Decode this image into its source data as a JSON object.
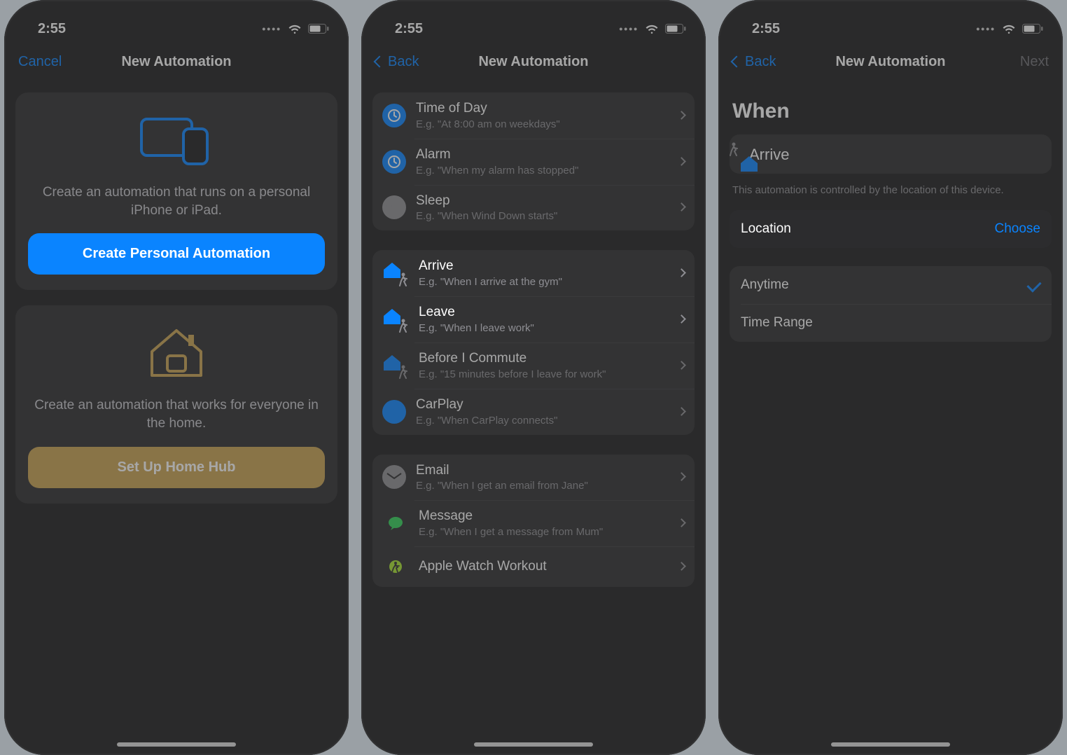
{
  "status": {
    "time": "2:55"
  },
  "screen1": {
    "nav_left": "Cancel",
    "nav_title": "New Automation",
    "personal_desc": "Create an automation that runs on a personal iPhone or iPad.",
    "personal_btn": "Create Personal Automation",
    "home_desc": "Create an automation that works for everyone in the home.",
    "home_btn": "Set Up Home Hub"
  },
  "screen2": {
    "nav_left": "Back",
    "nav_title": "New Automation",
    "groups": [
      [
        {
          "title": "Time of Day",
          "sub": "E.g. \"At 8:00 am on weekdays\"",
          "icon": "clock"
        },
        {
          "title": "Alarm",
          "sub": "E.g. \"When my alarm has stopped\"",
          "icon": "clock"
        },
        {
          "title": "Sleep",
          "sub": "E.g. \"When Wind Down starts\"",
          "icon": "bed"
        }
      ],
      [
        {
          "title": "Arrive",
          "sub": "E.g. \"When I arrive at the gym\"",
          "icon": "housewalker",
          "hl": true
        },
        {
          "title": "Leave",
          "sub": "E.g. \"When I leave work\"",
          "icon": "housewalker",
          "hl": true
        },
        {
          "title": "Before I Commute",
          "sub": "E.g. \"15 minutes before I leave for work\"",
          "icon": "housewalker"
        },
        {
          "title": "CarPlay",
          "sub": "E.g. \"When CarPlay connects\"",
          "icon": "carplay"
        }
      ],
      [
        {
          "title": "Email",
          "sub": "E.g. \"When I get an email from Jane\"",
          "icon": "mail"
        },
        {
          "title": "Message",
          "sub": "E.g. \"When I get a message from Mum\"",
          "icon": "message"
        },
        {
          "title": "Apple Watch Workout",
          "sub": "",
          "icon": "workout"
        }
      ]
    ]
  },
  "screen3": {
    "nav_left": "Back",
    "nav_title": "New Automation",
    "nav_right": "Next",
    "section": "When",
    "arrive": "Arrive",
    "note": "This automation is controlled by the location of this device.",
    "location_label": "Location",
    "location_action": "Choose",
    "opt_anytime": "Anytime",
    "opt_range": "Time Range"
  }
}
